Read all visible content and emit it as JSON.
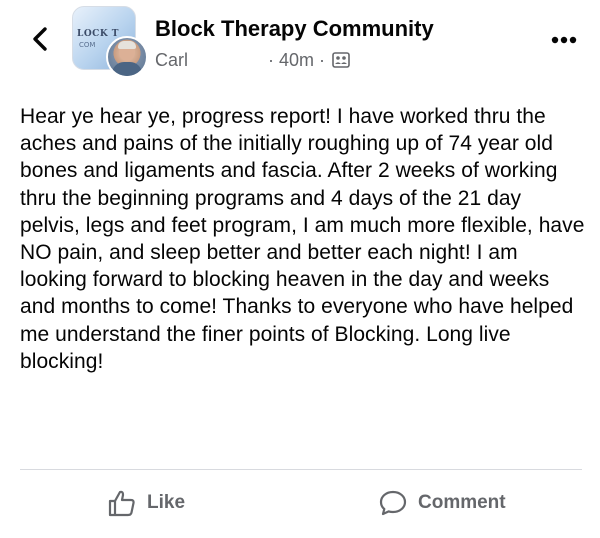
{
  "header": {
    "group_name": "Block Therapy Community",
    "author": "Carl",
    "time": "40m",
    "separator": "·",
    "group_logo_text": "LOCK T",
    "group_logo_sub": "COM"
  },
  "post": {
    "text": "Hear ye hear ye, progress report! I have worked thru the aches and pains of the initially roughing up of 74 year old bones and ligaments and fascia. After 2 weeks of working thru the beginning programs and 4 days of the 21 day pelvis, legs and feet program, I am much more flexible, have NO pain, and sleep better and better each night! I am looking forward to blocking heaven in the day and weeks and months to come! Thanks to everyone who have helped me understand the finer points of Blocking. Long live blocking!"
  },
  "actions": {
    "like_label": "Like",
    "comment_label": "Comment"
  },
  "icons": {
    "back": "chevron-left-icon",
    "more": "more-dots-icon",
    "privacy": "group-privacy-icon",
    "like": "thumbs-up-icon",
    "comment": "comment-bubble-icon"
  },
  "colors": {
    "text_primary": "#050505",
    "text_secondary": "#65676b",
    "divider": "#d8dadf"
  }
}
